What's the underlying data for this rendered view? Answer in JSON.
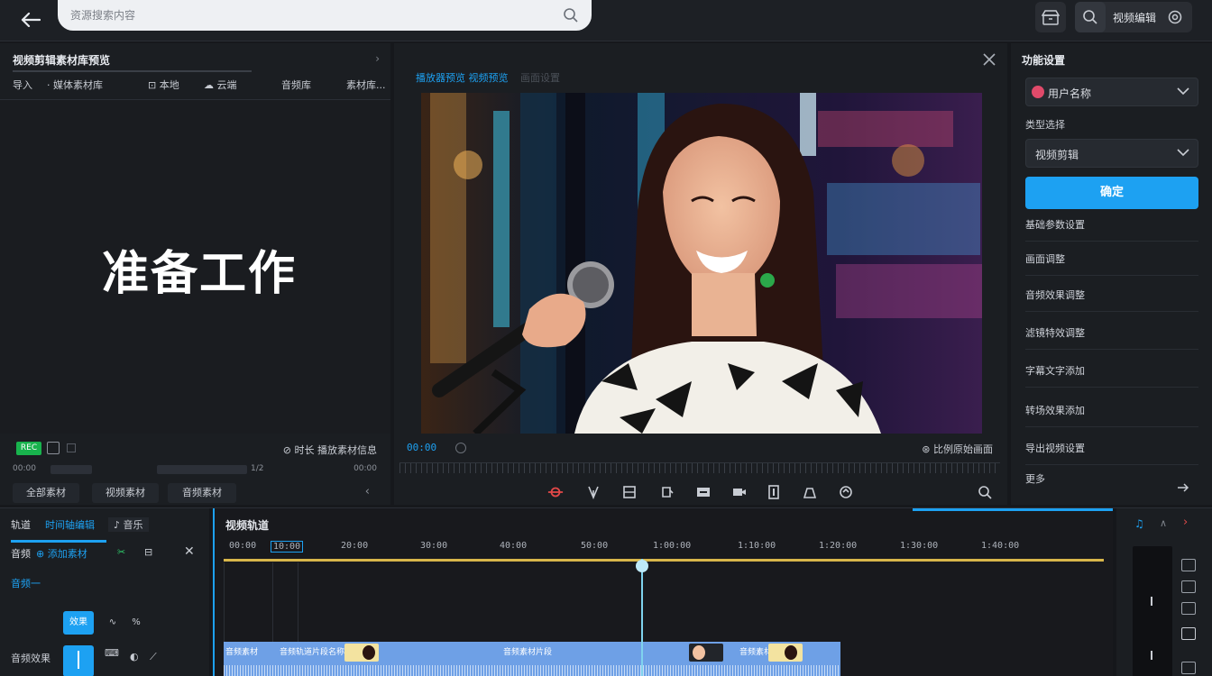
{
  "topbar": {
    "search_placeholder": "资源搜索内容",
    "right_label": "视频编辑"
  },
  "left_panel": {
    "title": "视频剪辑素材库预览",
    "tabs": [
      "导入",
      "· 媒体素材库",
      "⊡ 本地",
      "☁ 云端",
      "音频库",
      "素材库..."
    ],
    "big_title": "准备工作",
    "status_badge": "REC",
    "status_right": "⊘ 时长  播放素材信息",
    "scrub_left": "00:00",
    "scrub_mid": "1/2",
    "scrub_right": "00:00",
    "bottom_tabs": [
      "全部素材",
      "视频素材",
      "音频素材"
    ]
  },
  "center_panel": {
    "header_active": "播放器预览  视频预览",
    "header_muted": "画面设置",
    "controls_right": "⊛ 比例原始画面",
    "controls_left": "00:00"
  },
  "right_panel": {
    "title": "功能设置",
    "select_user": "用户名称",
    "label_type": "类型选择",
    "select_type": "视频剪辑",
    "primary_button": "确定",
    "items": [
      "基础参数设置",
      "画面调整",
      "音频效果调整",
      "滤镜特效调整",
      "字幕文字添加",
      "转场效果添加",
      "导出视频设置"
    ],
    "last_item": "更多"
  },
  "bottom_left": {
    "tabs": [
      "轨道",
      "时间轴编辑",
      "♪ 音乐"
    ],
    "row2": [
      "音频",
      "⊕ 添加素材",
      "✂",
      "⊟"
    ],
    "section": "音频一",
    "cells": [
      "效果",
      "∿",
      "%"
    ],
    "row4_label": "音频效果",
    "row4_icons": [
      "⌨",
      "◐",
      "⟋"
    ]
  },
  "timeline": {
    "title": "视频轨道",
    "ticks": [
      "00:00",
      "10:00",
      "20:00",
      "30:00",
      "40:00",
      "50:00",
      "1:00:00",
      "1:10:00",
      "1:20:00",
      "1:30:00",
      "1:40:00"
    ],
    "clip_labels": [
      "音频素材",
      "音频轨道片段名称",
      "音频素材片段",
      "音频素材"
    ]
  },
  "colors": {
    "accent": "#1da1f2",
    "background": "#16181c",
    "panel": "#1b1e22",
    "rec_green": "#18b34d",
    "gold_line": "#d8b64a",
    "clip_blue": "#6ea0e6"
  }
}
